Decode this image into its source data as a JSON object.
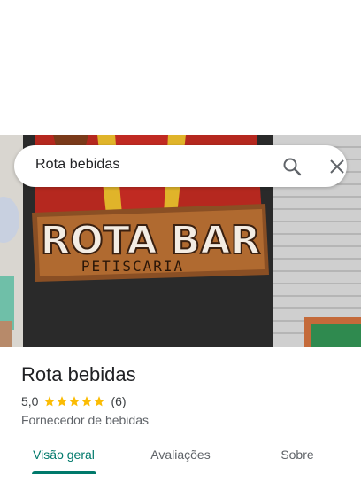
{
  "search": {
    "query": "Rota bebidas"
  },
  "hero": {
    "sign_main": "ROTA BAR",
    "sign_sub": "PETISCARIA"
  },
  "place": {
    "name": "Rota bebidas",
    "rating": "5,0",
    "stars": 5,
    "review_count": "(6)",
    "category": "Fornecedor de bebidas"
  },
  "tabs": [
    {
      "label": "Visão geral",
      "active": true
    },
    {
      "label": "Avaliações",
      "active": false
    },
    {
      "label": "Sobre",
      "active": false
    }
  ],
  "colors": {
    "accent": "#00796b",
    "star": "#fbbc04"
  }
}
